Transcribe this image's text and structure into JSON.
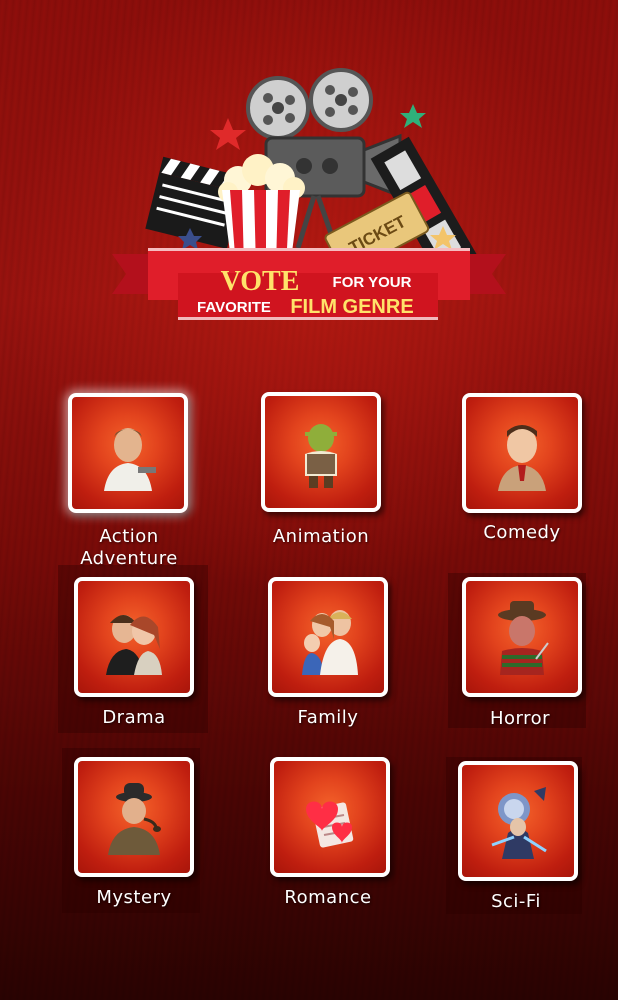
{
  "logo": {
    "line1_big": "VOTE",
    "line1_small": "FOR YOUR",
    "line2_small": "FAVORITE",
    "line2_big": "FILM GENRE",
    "ticket": "TICKET"
  },
  "genres": [
    {
      "label": "Action",
      "label2": "Adventure",
      "icon": "action-hero-icon"
    },
    {
      "label": "Animation",
      "icon": "ogre-icon"
    },
    {
      "label": "Comedy",
      "icon": "comedian-icon"
    },
    {
      "label": "Drama",
      "icon": "couple-icon"
    },
    {
      "label": "Family",
      "icon": "family-icon"
    },
    {
      "label": "Horror",
      "icon": "horror-villain-icon"
    },
    {
      "label": "Mystery",
      "icon": "detective-icon"
    },
    {
      "label": "Romance",
      "icon": "hearts-letter-icon"
    },
    {
      "label": "Sci-Fi",
      "icon": "space-fighter-icon"
    }
  ],
  "colors": {
    "banner_red": "#e01e2a",
    "banner_yellow": "#ffe36a",
    "tile_orange": "#e2431d"
  }
}
